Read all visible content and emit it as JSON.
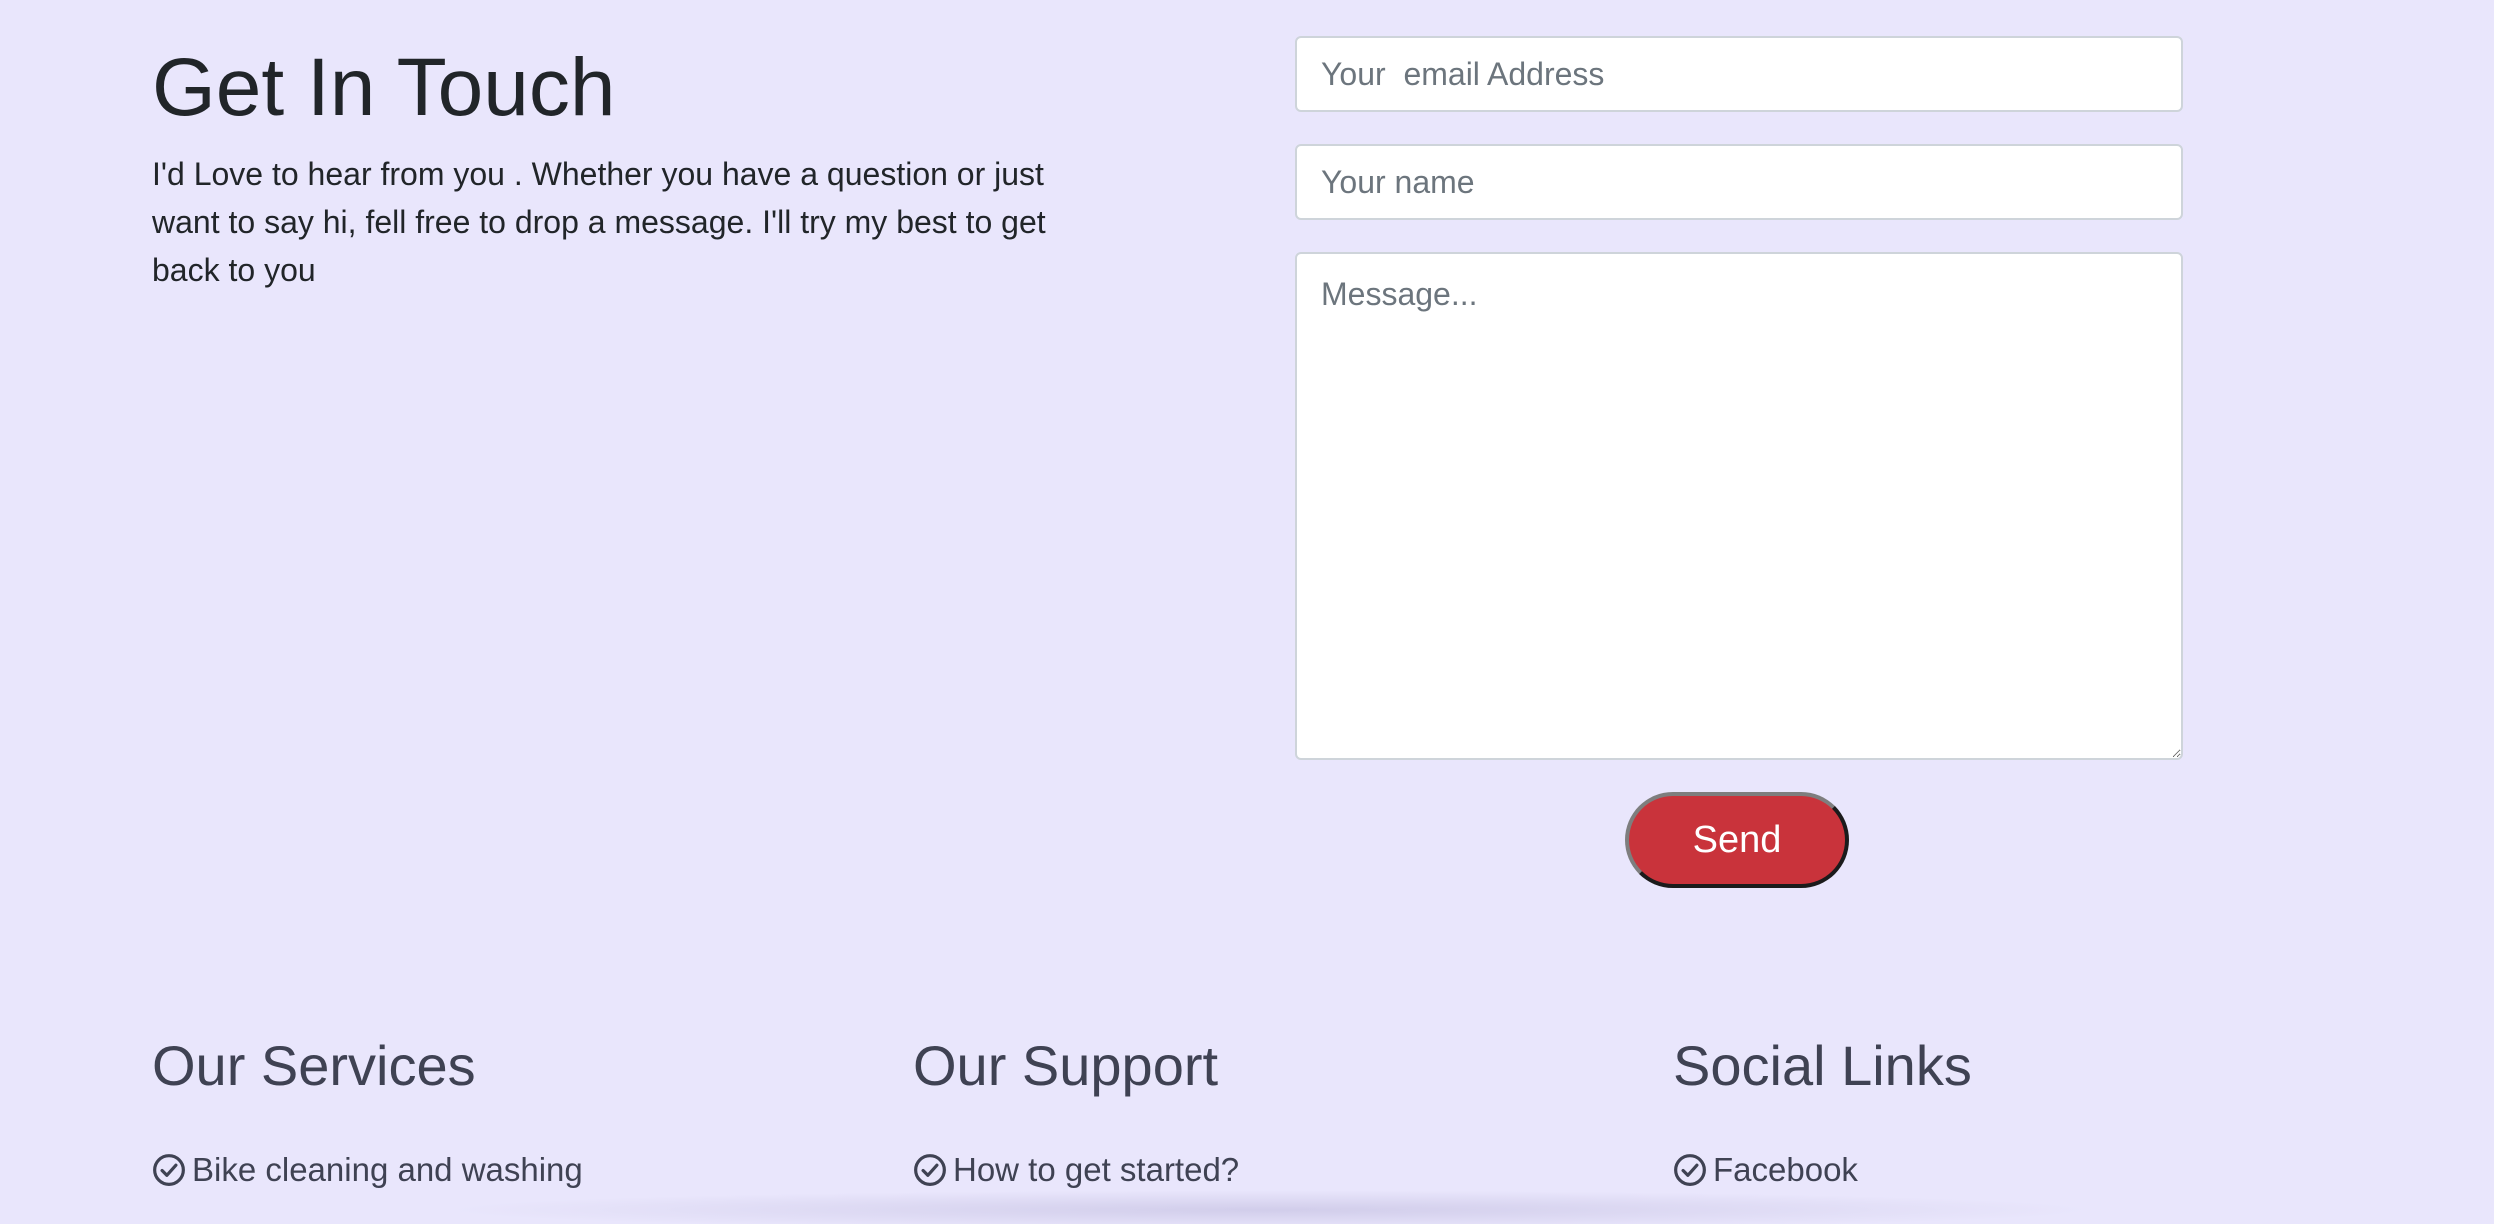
{
  "contact": {
    "title": "Get In Touch",
    "intro": "I'd Love to hear from you . Whether you have a question or just want to say hi, fell free to drop a message. I'll try my best to get back to you"
  },
  "form": {
    "email_placeholder": "Your  email Address",
    "email_value": "",
    "name_placeholder": "Your name",
    "name_value": "",
    "message_placeholder": "Message...",
    "message_value": "",
    "send_label": "Send"
  },
  "footer": {
    "columns": [
      {
        "title": "Our Services",
        "items": [
          {
            "label": "Bike cleaning and washing",
            "icon": "check-circle-icon"
          }
        ]
      },
      {
        "title": "Our Support",
        "items": [
          {
            "label": "How to get started?",
            "icon": "check-circle-icon"
          }
        ]
      },
      {
        "title": "Social Links",
        "items": [
          {
            "label": "Facebook",
            "icon": "check-circle-icon"
          }
        ]
      }
    ]
  },
  "colors": {
    "background": "#e9e6fc",
    "send_button": "#c9333b",
    "footer_text": "#3f4253"
  }
}
